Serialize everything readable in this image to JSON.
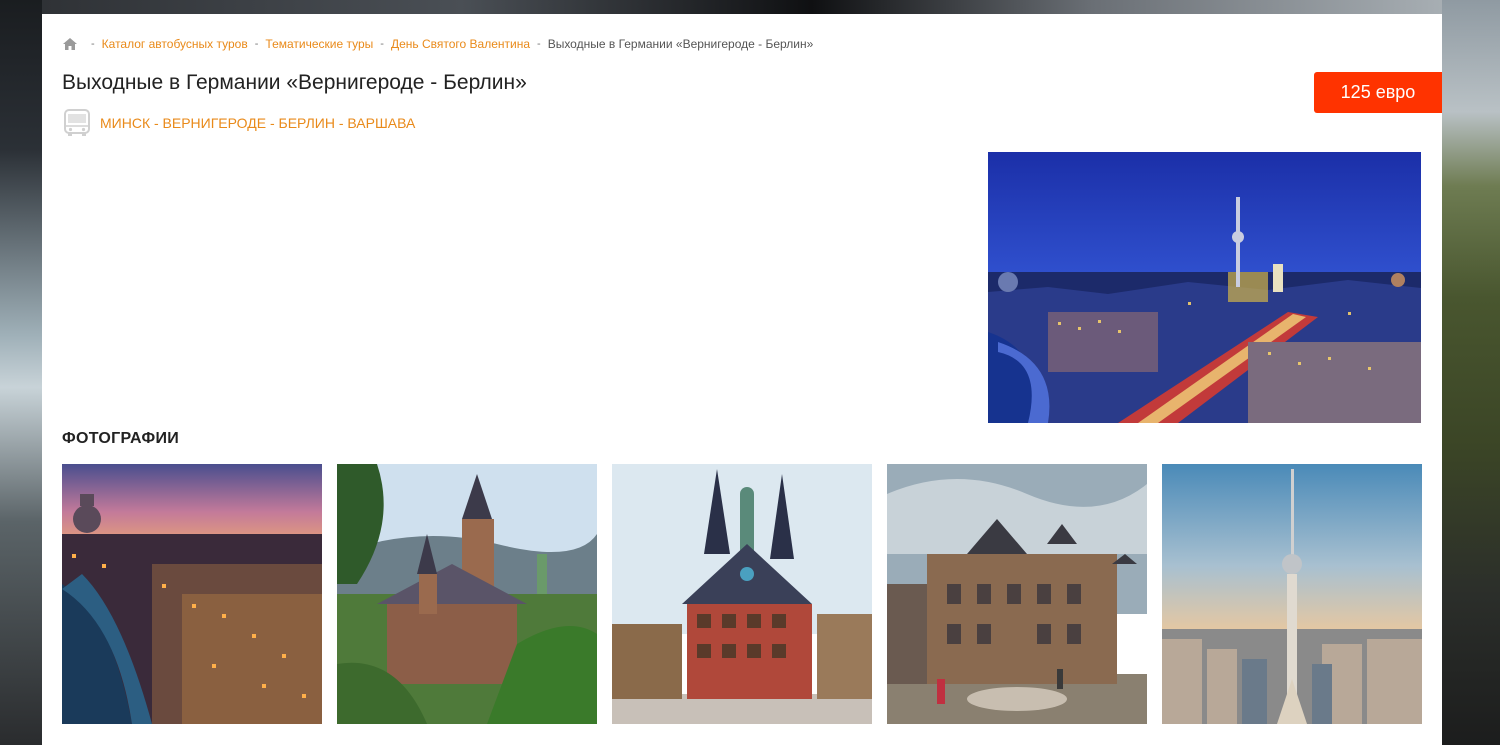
{
  "breadcrumb": {
    "items": [
      {
        "label": "Каталог автобусных туров"
      },
      {
        "label": "Тематические туры"
      },
      {
        "label": "День Святого Валентина"
      }
    ],
    "current": "Выходные в Германии «Вернигероде - Берлин»",
    "separator": "-"
  },
  "tour": {
    "title": "Выходные в Германии «Вернигероде - Берлин»",
    "price": "125 евро",
    "route": "МИНСК - ВЕРНИГЕРОДЕ - БЕРЛИН - ВАРШАВА"
  },
  "gallery": {
    "title": "ФОТОГРАФИИ",
    "photos": [
      {
        "subject": "berlin-river-dusk"
      },
      {
        "subject": "wernigerode-castle"
      },
      {
        "subject": "wernigerode-town-hall"
      },
      {
        "subject": "castle-courtyard"
      },
      {
        "subject": "berlin-tv-tower"
      }
    ]
  },
  "colors": {
    "accent": "#e98a1a",
    "price_bg": "#ff3300",
    "text": "#222222"
  },
  "icons": {
    "home": "home-icon",
    "bus": "bus-icon"
  }
}
